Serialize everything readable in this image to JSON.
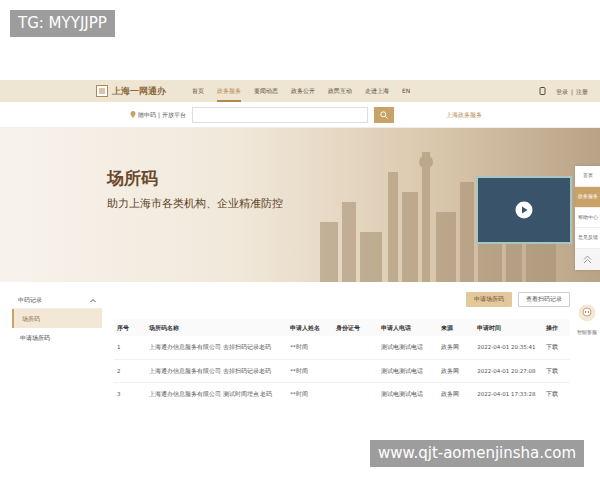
{
  "watermarks": [
    "TG: MYYJJPP",
    "www.qjt-aomenjinsha.com"
  ],
  "header": {
    "logo": "上海一网通办",
    "nav": [
      {
        "label": "首页",
        "selected": false
      },
      {
        "label": "政务服务",
        "selected": true
      },
      {
        "label": "要闻动态",
        "selected": false
      },
      {
        "label": "政务公开",
        "selected": false
      },
      {
        "label": "政民互动",
        "selected": false
      },
      {
        "label": "走进上海",
        "selected": false
      },
      {
        "label": "EN",
        "selected": false
      }
    ],
    "login": "登录",
    "separator": "|",
    "register": "注册"
  },
  "search": {
    "location": "随申码 | 开放平台",
    "right_text": "上海政务服务"
  },
  "banner": {
    "title": "场所码",
    "subtitle": "助力上海市各类机构、企业精准防控"
  },
  "float_toolbar": [
    {
      "label": "首页",
      "selected": false
    },
    {
      "label": "政务服务",
      "selected": true
    },
    {
      "label": "帮助中心",
      "selected": false
    },
    {
      "label": "意见反馈",
      "selected": false
    }
  ],
  "assistant": "智能客服",
  "sidebar": {
    "header": "申码记录",
    "items": [
      {
        "label": "场所码",
        "selected": true
      },
      {
        "label": "申请场所码",
        "selected": false
      }
    ]
  },
  "actions": [
    {
      "label": "申请场所码",
      "kind": "primary"
    },
    {
      "label": "查看扫码记录",
      "kind": "outline"
    }
  ],
  "table": {
    "columns": [
      "序号",
      "场所码名称",
      "申请人姓名",
      "身份证号",
      "申请人电话",
      "来源",
      "申请时间",
      "操作"
    ],
    "rows": [
      [
        "1",
        "上海通办信息服务有限公司 去掉扫码记录老码",
        "**时间",
        "",
        "测试电测试电话",
        "政务网",
        "2022-04-01 20:35:41",
        "下载"
      ],
      [
        "2",
        "上海通办信息服务有限公司 去掉扫码记录老码",
        "**时间",
        "",
        "测试电测试电话",
        "政务网",
        "2022-04-01 20:27:08",
        "下载"
      ],
      [
        "3",
        "上海通办信息服务有限公司 测试时间埋点 老码",
        "**时间",
        "",
        "测试电测试电话",
        "政务网",
        "2022-04-01 17:33:28",
        "下载"
      ]
    ]
  }
}
